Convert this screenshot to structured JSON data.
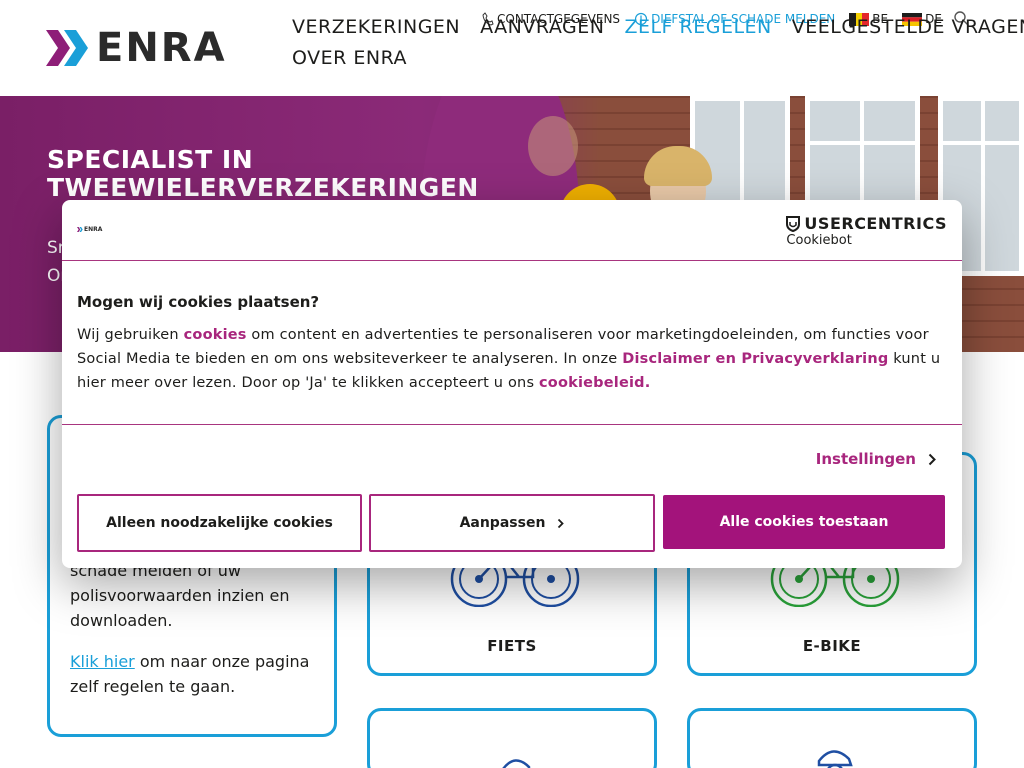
{
  "brand": {
    "name": "ENRA",
    "accent": "#a3137b",
    "blue": "#1a9fd8"
  },
  "nav": {
    "items": [
      "VERZEKERINGEN",
      "AANVRAGEN",
      "ZELF REGELEN",
      "VEELGESTELDE VRAGEN"
    ],
    "row2": [
      "OVER ENRA"
    ],
    "active": "ZELF REGELEN"
  },
  "top_links": {
    "contact": "CONTACTGEGEVENS",
    "report": "DIEFSTAL OF SCHADE MELDEN",
    "lang_be": "BE",
    "lang_de": "DE"
  },
  "hero": {
    "title": "SPECIALIST IN TWEEWIELERVERZEKERINGEN",
    "sub_line1": "Sn",
    "sub_line2": "Or"
  },
  "left_card": {
    "line1": "schade melden of uw",
    "line2": "polisvoorwaarden inzien en",
    "line3": "downloaden.",
    "link": "Klik hier",
    "after_link": " om naar onze pagina",
    "line5": "zelf regelen te gaan."
  },
  "products": [
    {
      "label": "FIETS",
      "color": "#1f4fa3"
    },
    {
      "label": "E-BIKE",
      "color": "#2aa33a"
    }
  ],
  "cookie": {
    "logo_text": "ENRA",
    "provider_top": "USERCENTRICS",
    "provider_bottom": "Cookiebot",
    "title": "Mogen wij cookies plaatsen?",
    "body_1": "Wij gebruiken ",
    "link_cookies": "cookies",
    "body_2": " om content en advertenties te personaliseren voor marketingdoeleinden, om functies voor Social Media te bieden en om ons websiteverkeer te analyseren. In onze ",
    "link_privacy": "Disclaimer en Privacyverklaring",
    "body_3": " kunt u hier meer over lezen. Door op 'Ja' te klikken accepteert u ons ",
    "link_policy": "cookiebeleid.",
    "settings": "Instellingen",
    "btn_necessary": "Alleen noodzakelijke cookies",
    "btn_customize": "Aanpassen",
    "btn_allow_all": "Alle cookies toestaan"
  }
}
